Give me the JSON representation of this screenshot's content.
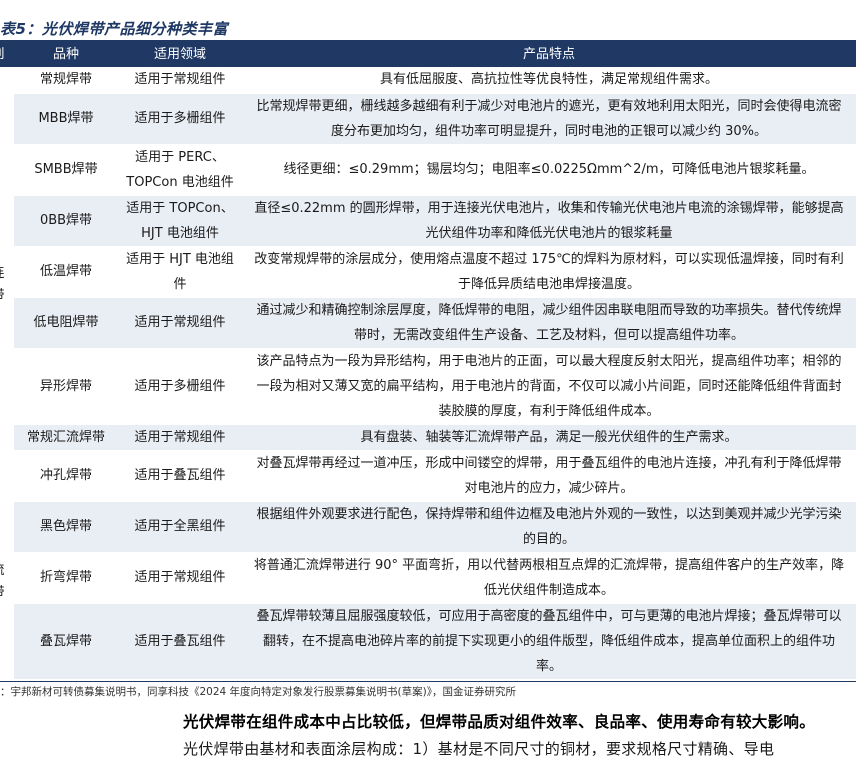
{
  "table_title": "表5：光伏焊带产品细分种类丰富",
  "headers": {
    "category": "别",
    "name": "品种",
    "field": "适用领域",
    "feature": "产品特点"
  },
  "groups": {
    "lian": "连",
    "dai1": "带",
    "liu": "流",
    "dai2": "带"
  },
  "rows": [
    {
      "name": "常规焊带",
      "field": "适用于常规组件",
      "feature": "具有低屈服度、高抗拉性等优良特性，满足常规组件需求。"
    },
    {
      "name": "MBB焊带",
      "field": "适用于多栅组件",
      "feature": "比常规焊带更细，栅线越多越细有利于减少对电池片的遮光，更有效地利用太阳光，同时会使得电流密度分布更加均匀，组件功率可明显提升，同时电池的正银可以减少约 30%。"
    },
    {
      "name": "SMBB焊带",
      "field": "适用于 PERC、TOPCon 电池组件",
      "feature": "线径更细：≤0.29mm；锡层均匀；电阻率≤0.0225Ωmm^2/m，可降低电池片银浆耗量。"
    },
    {
      "name": "0BB焊带",
      "field": "适用于 TOPCon、HJT 电池组件",
      "feature": "直径≤0.22mm 的圆形焊带，用于连接光伏电池片，收集和传输光伏电池片电流的涂锡焊带，能够提高光伏组件功率和降低光伏电池片的银浆耗量"
    },
    {
      "name": "低温焊带",
      "field": "适用于 HJT 电池组件",
      "feature": "改变常规焊带的涂层成分，使用熔点温度不超过 175℃的焊料为原材料，可以实现低温焊接，同时有利于降低异质结电池串焊接温度。"
    },
    {
      "name": "低电阻焊带",
      "field": "适用于常规组件",
      "feature": "通过减少和精确控制涂层厚度，降低焊带的电阻，减少组件因串联电阻而导致的功率损失。替代传统焊带时，无需改变组件生产设备、工艺及材料，但可以提高组件功率。"
    },
    {
      "name": "异形焊带",
      "field": "适用于多栅组件",
      "feature": "该产品特点为一段为异形结构，用于电池片的正面，可以最大程度反射太阳光，提高组件功率；相邻的一段为相对又薄又宽的扁平结构，用于电池片的背面，不仅可以减小片间距，同时还能降低组件背面封装胶膜的厚度，有利于降低组件成本。"
    },
    {
      "name": "常规汇流焊带",
      "field": "适用于常规组件",
      "feature": "具有盘装、轴装等汇流焊带产品，满足一般光伏组件的生产需求。"
    },
    {
      "name": "冲孔焊带",
      "field": "适用于叠瓦组件",
      "feature": "对叠瓦焊带再经过一道冲压，形成中间镂空的焊带，用于叠瓦组件的电池片连接，冲孔有利于降低焊带对电池片的应力，减少碎片。"
    },
    {
      "name": "黑色焊带",
      "field": "适用于全黑组件",
      "feature": "根据组件外观要求进行配色，保持焊带和组件边框及电池片外观的一致性，以达到美观并减少光学污染的目的。"
    },
    {
      "name": "折弯焊带",
      "field": "适用于常规组件",
      "feature": "将普通汇流焊带进行 90° 平面弯折，用以代替两根相互点焊的汇流焊带，提高组件客户的生产效率，降低光伏组件制造成本。"
    },
    {
      "name": "叠瓦焊带",
      "field": "适用于叠瓦组件",
      "feature": "叠瓦焊带较薄且屈服强度较低，可应用于高密度的叠瓦组件中，可与更薄的电池片焊接；叠瓦焊带可以翻转，在不提高电池碎片率的前提下实现更小的组件版型，降低组件成本，提高单位面积上的组件功率。"
    }
  ],
  "source": "：宇邦新材可转债募集说明书，同享科技《2024 年度向特定对象发行股票募集说明书(草案)》，国金证券研究所",
  "paragraph_heading": "光伏焊带在组件成本中占比较低，但焊带品质对组件效率、良品率、使用寿命有较大影响。",
  "paragraph_text": "光伏焊带由基材和表面涂层构成：1）基材是不同尺寸的铜材，要求规格尺寸精确、导电",
  "colors": {
    "header_bg": "#1f3864",
    "stripe_bg": "#e9edf4",
    "title_color": "#1f3864"
  }
}
